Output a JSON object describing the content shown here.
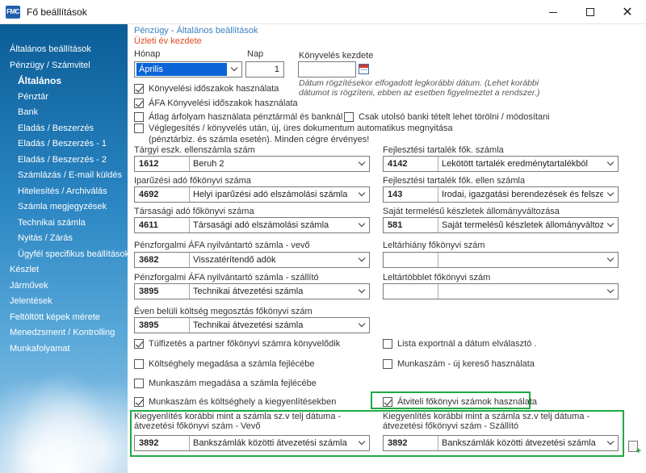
{
  "window": {
    "title": "Fő beállítások",
    "app_icon_text": "FMC"
  },
  "sidebar": {
    "items": [
      {
        "label": "Általános beállítások",
        "level": 0
      },
      {
        "label": "Pénzügy / Számvitel",
        "level": 0
      },
      {
        "label": "Általános",
        "level": 1,
        "active": true
      },
      {
        "label": "Pénztár",
        "level": 1
      },
      {
        "label": "Bank",
        "level": 1
      },
      {
        "label": "Eladás / Beszerzés",
        "level": 1
      },
      {
        "label": "Eladás / Beszerzés - 1",
        "level": 1
      },
      {
        "label": "Eladás / Beszerzés - 2",
        "level": 1
      },
      {
        "label": "Számlázás / E-mail küldés",
        "level": 1
      },
      {
        "label": "Hitelesítés / Archiválás",
        "level": 1
      },
      {
        "label": "Számla megjegyzések",
        "level": 1
      },
      {
        "label": "Technikai számla",
        "level": 1
      },
      {
        "label": "Nyitás / Zárás",
        "level": 1
      },
      {
        "label": "Ügyfél specifikus beállítások",
        "level": 1
      },
      {
        "label": "Készlet",
        "level": 0
      },
      {
        "label": "Járművek",
        "level": 0
      },
      {
        "label": "Jelentések",
        "level": 0
      },
      {
        "label": "Feltöltött képek mérete",
        "level": 0
      },
      {
        "label": "Menedzsment / Kontrolling",
        "level": 0
      },
      {
        "label": "Munkafolyamat",
        "level": 0
      }
    ]
  },
  "header": {
    "title": "Pénzügy - Általános beállítások",
    "subtitle": "Üzleti év kezdete"
  },
  "fiscal": {
    "month_label": "Hónap",
    "month_value": "Április",
    "day_label": "Nap",
    "day_value": "1",
    "start_label": "Könyvelés kezdete",
    "start_value": "",
    "hint": "Dátum rögzítésekor elfogadott legkorábbi dátum. (Lehet korábbi dátumot is rögzíteni, ebben az esetben figyelmeztet a rendszer.)"
  },
  "checks_top": [
    {
      "label": "Könyvelési időszakok használata",
      "checked": true
    },
    {
      "label": "ÁFA Könyvelési időszakok használata",
      "checked": true
    },
    {
      "label": "Átlag árfolyam használata pénztármál és banknál",
      "checked": false
    },
    {
      "label": "Csak utolsó banki tételt lehet törölni / módosítani",
      "checked": false
    },
    {
      "label": "Véglegesítés / könyvelés után, új, üres dokumentum automatikus megnyitása (pénztárbiz. és számla esetén). Minden cégre érvényes!",
      "checked": false
    }
  ],
  "accounts": {
    "targyi": {
      "label": "Tárgyi eszk. ellenszámla szám",
      "code": "1612",
      "name": "Beruh 2"
    },
    "fejlesztesi": {
      "label": "Fejlesztési tartalék fők. számla",
      "code": "4142",
      "name": "Lekötött tartalék eredménytartalékból"
    },
    "iparuzesi": {
      "label": "Iparűzési adó főkönyvi száma",
      "code": "4692",
      "name": "Helyi iparűzési adó elszámolási számla"
    },
    "fejlesztesi_ellen": {
      "label": "Fejlesztési tartalék fők. ellen számla",
      "code": "143",
      "name": "Irodai, igazgatási berendezések és felszerelés"
    },
    "tarsasagi": {
      "label": "Társasági adó főkönyvi száma",
      "code": "4611",
      "name": "Társasági adó elszámolási számla"
    },
    "sajat": {
      "label": "Saját termelésű készletek állományváltozása",
      "code": "581",
      "name": "Saját termelésű készletek állományváltozása"
    },
    "afa_vevo": {
      "label": "Pénzforgalmi ÁFA nyilvántartó számla - vevő",
      "code": "3682",
      "name": "Visszatérítendő adók"
    },
    "leltarhiany": {
      "label": "Leltárhiány főkönyvi szám",
      "code": "",
      "name": ""
    },
    "afa_szallito": {
      "label": "Pénzforgalmi ÁFA nyilvántartó számla - szállító",
      "code": "3895",
      "name": "Technikai átvezetési számla"
    },
    "leltartobblet": {
      "label": "Leltártöbblet főkönyvi szám",
      "code": "",
      "name": ""
    },
    "even_belul": {
      "label": "Éven belüli költség megosztás főkönyvi szám",
      "code": "3895",
      "name": "Technikai átvezetési számla"
    },
    "kiegy_vevo": {
      "label": "Kiegyenlítés korábbi mint a számla sz.v telj dátuma - átvezetési főkönyvi szám - Vevő",
      "code": "3892",
      "name": "Bankszámlák közötti átvezetési számla"
    },
    "kiegy_szallito": {
      "label": "Kiegyenlítés korábbi mint a számla sz.v telj dátuma - átvezetési főkönyvi szám - Szállító",
      "code": "3892",
      "name": "Bankszámlák közötti átvezetési számla"
    }
  },
  "checks_bottom": [
    {
      "label": "Túlfizetés a partner főkönyvi számra könyvelődik",
      "checked": true
    },
    {
      "label": "Lista exportnál a dátum elválasztó .",
      "checked": false
    },
    {
      "label": "Költséghely megadása a számla fejlécébe",
      "checked": false
    },
    {
      "label": "Munkaszám - új kereső használata",
      "checked": false
    },
    {
      "label": "Munkaszám megadása a számla fejlécébe",
      "checked": false
    },
    {
      "label": "Munkaszám és költséghely a kiegyenlítésekben",
      "checked": true
    },
    {
      "label": "Átviteli főkönyvi számok használata",
      "checked": true
    }
  ],
  "colors": {
    "accent": "#22a845",
    "title_blue": "#3a7fc1",
    "subtitle_red": "#e0491f",
    "selection": "#0a64d8"
  }
}
